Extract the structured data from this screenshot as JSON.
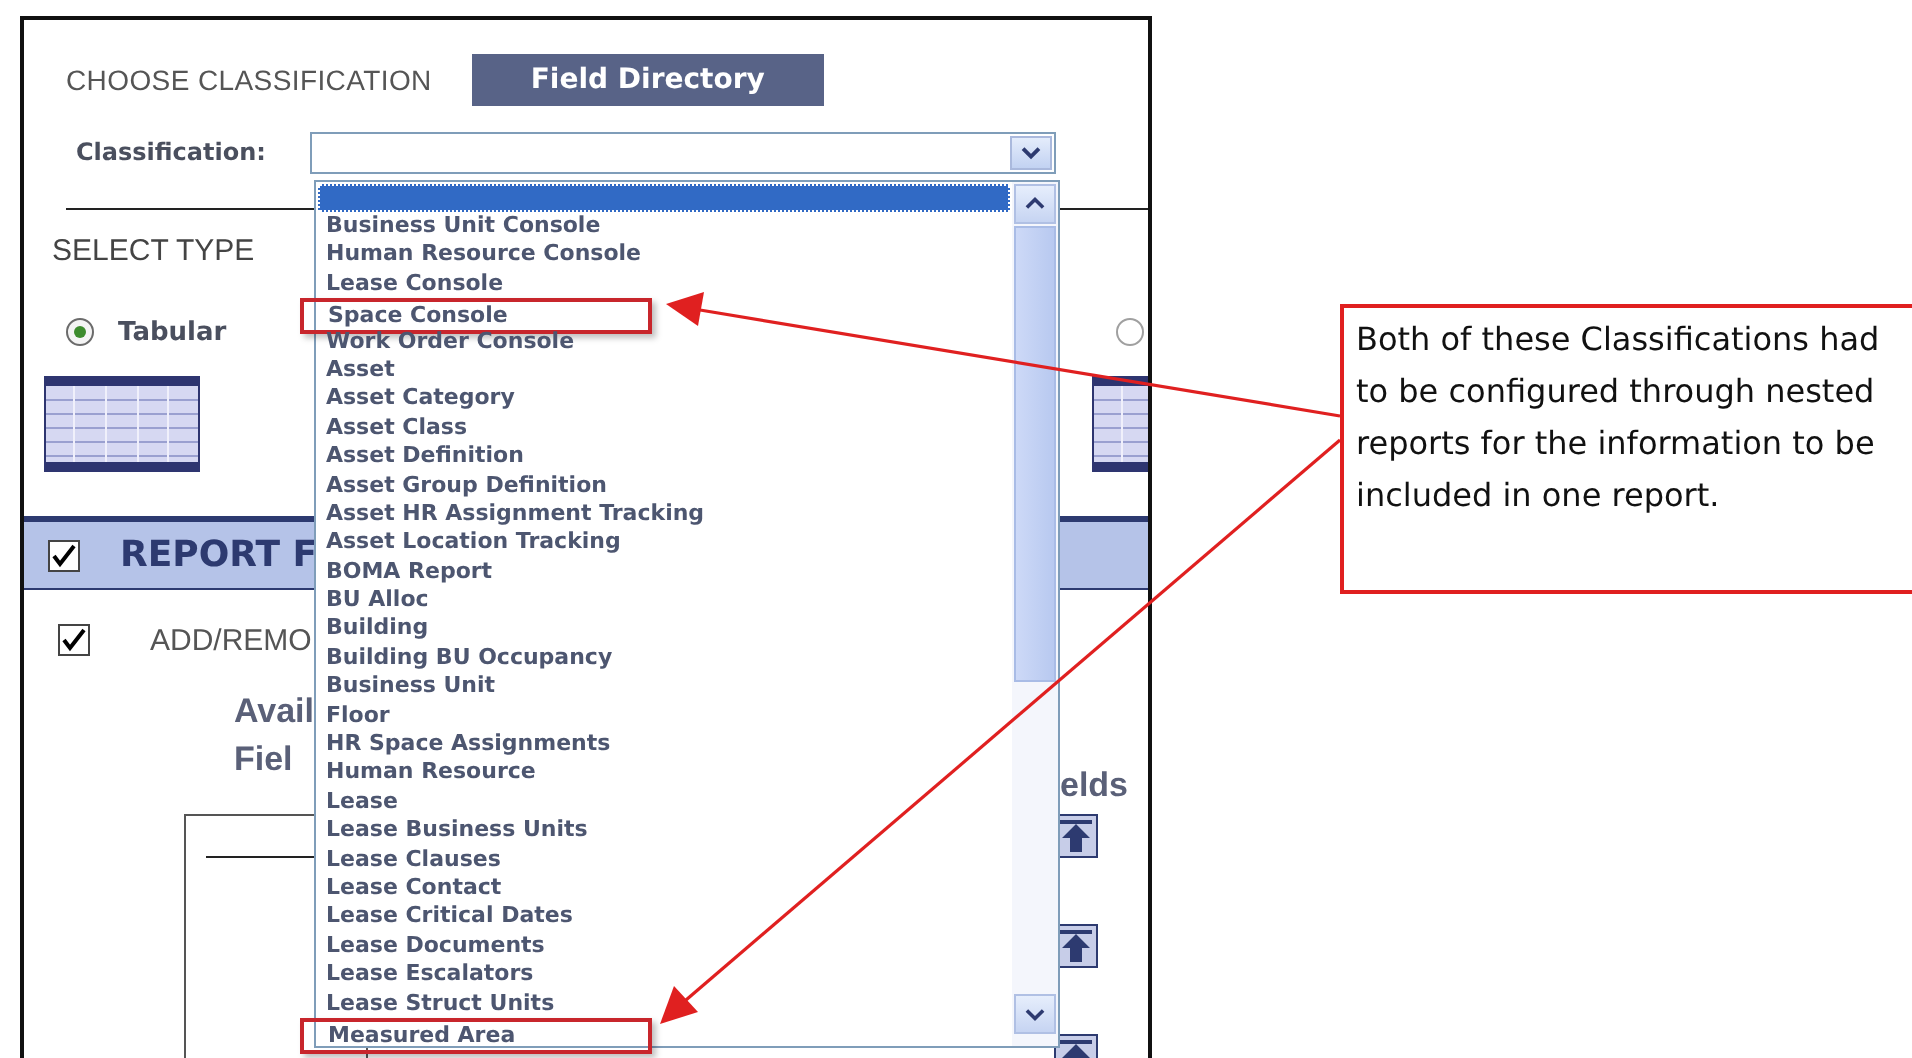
{
  "header": {
    "title": "CHOOSE CLASSIFICATION",
    "button": "Field Directory"
  },
  "classification": {
    "label": "Classification:"
  },
  "select_type": {
    "title": "SELECT TYPE",
    "options": [
      {
        "label": "Tabular",
        "selected": true
      },
      {
        "selected": false
      }
    ]
  },
  "report_section": {
    "checked": true,
    "title": "REPORT F"
  },
  "add_remove": {
    "checked": true,
    "label": "ADD/REMO"
  },
  "available_fields": {
    "lines": [
      "Avail",
      "Fiel"
    ]
  },
  "selected_fields_fragment": "elds",
  "dropdown": {
    "blank_option_selected": true,
    "options": [
      {
        "label": "Business Unit Console",
        "boxed": false
      },
      {
        "label": "Human Resource Console",
        "boxed": false
      },
      {
        "label": "Lease Console",
        "boxed": false
      },
      {
        "label": "Space Console",
        "boxed": true
      },
      {
        "label": "Work Order Console",
        "boxed": false
      },
      {
        "label": "Asset",
        "boxed": false
      },
      {
        "label": "Asset Category",
        "boxed": false
      },
      {
        "label": "Asset Class",
        "boxed": false
      },
      {
        "label": "Asset Definition",
        "boxed": false
      },
      {
        "label": "Asset Group Definition",
        "boxed": false
      },
      {
        "label": "Asset HR Assignment Tracking",
        "boxed": false
      },
      {
        "label": "Asset Location Tracking",
        "boxed": false
      },
      {
        "label": "BOMA Report",
        "boxed": false
      },
      {
        "label": "BU Alloc",
        "boxed": false
      },
      {
        "label": "Building",
        "boxed": false
      },
      {
        "label": "Building BU Occupancy",
        "boxed": false
      },
      {
        "label": "Business Unit",
        "boxed": false
      },
      {
        "label": "Floor",
        "boxed": false
      },
      {
        "label": "HR Space Assignments",
        "boxed": false
      },
      {
        "label": "Human Resource",
        "boxed": false
      },
      {
        "label": "Lease",
        "boxed": false
      },
      {
        "label": "Lease Business Units",
        "boxed": false
      },
      {
        "label": "Lease Clauses",
        "boxed": false
      },
      {
        "label": "Lease Contact",
        "boxed": false
      },
      {
        "label": "Lease Critical Dates",
        "boxed": false
      },
      {
        "label": "Lease Documents",
        "boxed": false
      },
      {
        "label": "Lease Escalators",
        "boxed": false
      },
      {
        "label": "Lease Struct Units",
        "boxed": false
      },
      {
        "label": "Measured Area",
        "boxed": true
      }
    ]
  },
  "callout": {
    "text": "Both of these Classifications had to be configured through nested reports for the information to be included in one report."
  }
}
